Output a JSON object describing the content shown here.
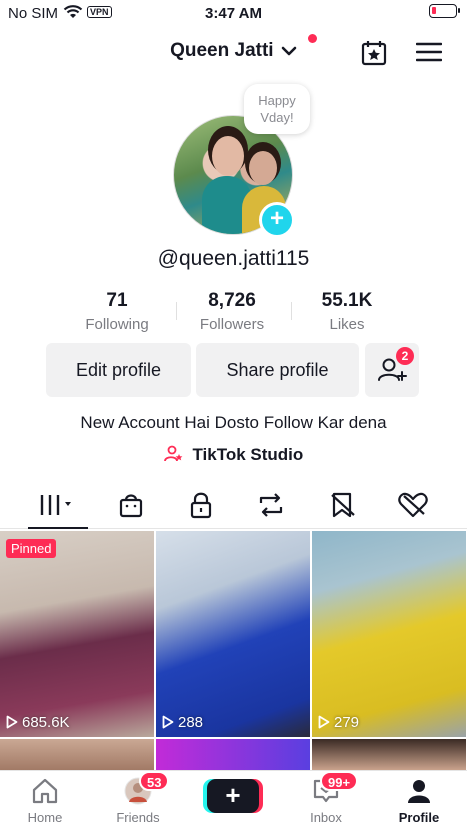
{
  "status_bar": {
    "carrier": "No SIM",
    "vpn": "VPN",
    "time": "3:47 AM"
  },
  "header": {
    "username": "Queen Jatti"
  },
  "profile": {
    "note": "Happy Vday!",
    "handle": "@queen.jatti115",
    "stats": [
      {
        "value": "71",
        "label": "Following"
      },
      {
        "value": "8,726",
        "label": "Followers"
      },
      {
        "value": "55.1K",
        "label": "Likes"
      }
    ],
    "edit_label": "Edit profile",
    "share_label": "Share profile",
    "add_friends_badge": "2",
    "bio": "New Account Hai Dosto Follow Kar dena",
    "studio_label": "TikTok Studio"
  },
  "tabs": [
    {
      "icon": "videos-grid-icon",
      "active": true
    },
    {
      "icon": "shop-bag-icon"
    },
    {
      "icon": "lock-icon"
    },
    {
      "icon": "repost-icon"
    },
    {
      "icon": "favorites-icon"
    },
    {
      "icon": "liked-icon"
    }
  ],
  "videos": [
    {
      "views": "685.6K",
      "pinned": "Pinned",
      "colors": [
        "#cfc3b8",
        "#6b2d4a"
      ]
    },
    {
      "views": "288",
      "colors": [
        "#c8d6e6",
        "#1f3fb0"
      ]
    },
    {
      "views": "279",
      "colors": [
        "#8fb6c9",
        "#e4c92a"
      ]
    }
  ],
  "bottom_nav": {
    "home": "Home",
    "friends": "Friends",
    "friends_badge": "53",
    "inbox": "Inbox",
    "inbox_badge": "99+",
    "profile": "Profile"
  },
  "colors": {
    "accent": "#fe2c55",
    "cyan": "#20d5ec",
    "text": "#161823",
    "muted": "#7a7b81"
  }
}
